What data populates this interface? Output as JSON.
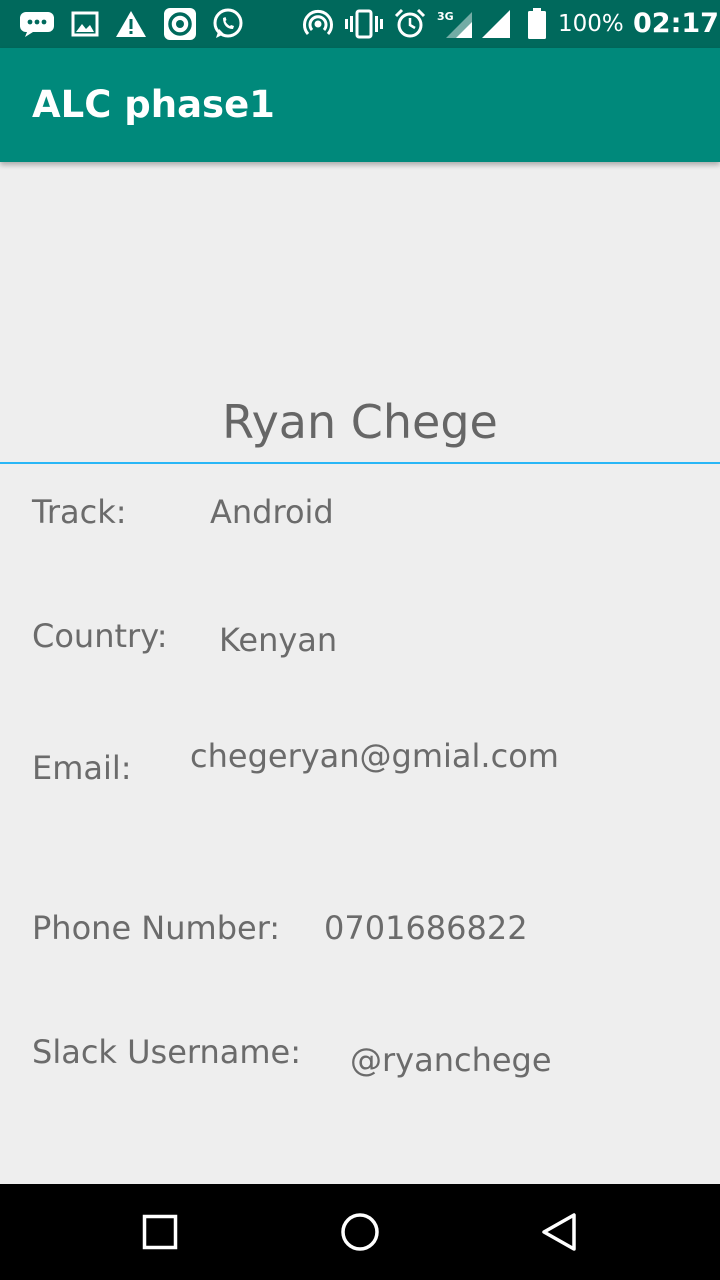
{
  "status_bar": {
    "icons": [
      "messaging-icon",
      "gallery-icon",
      "warning-icon",
      "camera-app-icon",
      "whatsapp-icon",
      "hotspot-icon",
      "vibrate-icon",
      "alarm-icon",
      "mobile-signal-3g-icon",
      "signal-icon",
      "battery-icon"
    ],
    "network_label": "3G",
    "battery_percent": "100%",
    "time": "02:17"
  },
  "app_bar": {
    "title": "ALC phase1"
  },
  "profile": {
    "name": "Ryan Chege",
    "fields": [
      {
        "label": "Track:",
        "value": "Android"
      },
      {
        "label": "Country:",
        "value": "Kenyan"
      },
      {
        "label": "Email:",
        "value": "chegeryan@gmial.com"
      },
      {
        "label": "Phone Number:",
        "value": "0701686822"
      },
      {
        "label": "Slack Username:",
        "value": "@ryanchege"
      }
    ]
  },
  "nav_bar": {
    "buttons": [
      "recents-button",
      "home-button",
      "back-button"
    ]
  },
  "colors": {
    "status_bar": "#00695c",
    "app_bar": "#00897b",
    "background": "#eeeeee",
    "divider": "#29b6f6",
    "text": "#6b6b6b"
  }
}
